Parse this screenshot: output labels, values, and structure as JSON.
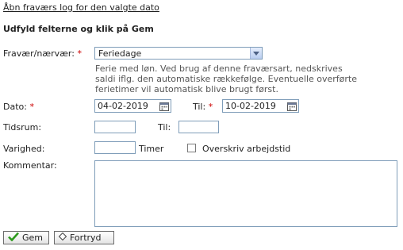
{
  "top_link": "Åbn fraværs log for den valgte dato",
  "instruction": "Udfyld felterne og klik på Gem",
  "form": {
    "absence_label": "Fravær/nærvær:",
    "absence_value": "Feriedage",
    "description": "Ferie med løn. Ved brug af denne fraværsart, nedskrives saldi iflg. den automatiske rækkefølge. Eventuelle overførte ferietimer vil automatisk blive brugt først.",
    "date_label": "Dato:",
    "date_from": "04-02-2019",
    "to_label": "Til:",
    "date_to": "10-02-2019",
    "time_label": "Tidsrum:",
    "time_to_label": "Til:",
    "duration_label": "Varighed:",
    "duration_unit": "Timer",
    "override_label": "Overskriv arbejdstid",
    "comment_label": "Kommentar:",
    "required_mark": "*"
  },
  "buttons": {
    "save": "Gem",
    "undo": "Fortryd"
  },
  "colors": {
    "required": "#cc0000",
    "border": "#7f9db9",
    "save_check": "#2e9a1e"
  }
}
